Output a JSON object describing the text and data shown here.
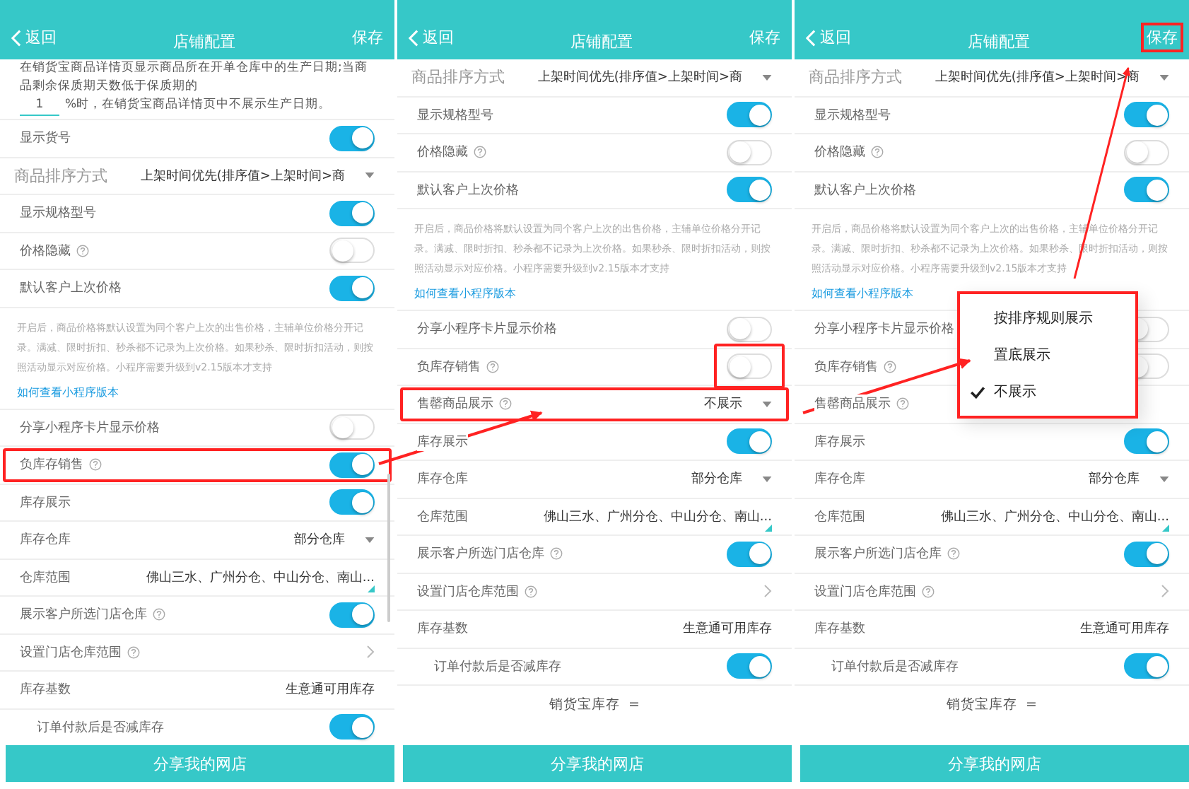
{
  "panels": [
    {
      "header": {
        "back": "返回",
        "title": "店铺配置",
        "save": "保存",
        "save_highlighted": false
      },
      "scrollbar": true,
      "rows": [
        {
          "kind": "note",
          "text_before": "在销货宝商品详情页显示商品所在开单仓库中的生产日期;当商品剩余保质期天数低于保质期的",
          "input": "1",
          "text_after": "%时，在销货宝商品详情页中不展示生产日期。"
        },
        {
          "kind": "toggle",
          "label": "显示货号",
          "help": false,
          "on": true,
          "highlighted": false,
          "switch_highlighted": false
        },
        {
          "kind": "select",
          "label": "商品排序方式",
          "value": "上架时间优先(排序值>上架时间>商",
          "help": false,
          "highlighted": false
        },
        {
          "kind": "toggle",
          "label": "显示规格型号",
          "help": false,
          "on": true,
          "highlighted": false,
          "switch_highlighted": false
        },
        {
          "kind": "toggle",
          "label": "价格隐藏",
          "help": true,
          "on": false,
          "highlighted": false,
          "switch_highlighted": false
        },
        {
          "kind": "toggle",
          "label": "默认客户上次价格",
          "help": false,
          "on": true,
          "highlighted": false,
          "switch_highlighted": false
        },
        {
          "kind": "info",
          "text": "开启后，商品价格将默认设置为同个客户上次的出售价格，主辅单位价格分开记录。满减、限时折扣、秒杀都不记录为上次价格。如果秒杀、限时折扣活动，则按照活动显示对应价格。小程序需要升级到v2.15版本才支持"
        },
        {
          "kind": "link",
          "text": "如何查看小程序版本"
        },
        {
          "kind": "toggle",
          "label": "分享小程序卡片显示价格",
          "help": false,
          "on": false,
          "highlighted": false,
          "switch_highlighted": false
        },
        {
          "kind": "toggle",
          "label": "负库存销售",
          "help": true,
          "on": true,
          "highlighted": true,
          "switch_highlighted": false
        },
        {
          "kind": "toggle",
          "label": "库存展示",
          "help": false,
          "on": true,
          "highlighted": false,
          "switch_highlighted": false
        },
        {
          "kind": "select",
          "label": "库存仓库",
          "value": "部分仓库",
          "help": false,
          "highlighted": false
        },
        {
          "kind": "range",
          "label": "仓库范围",
          "value": "佛山三水、广州分仓、中山分仓、南山..."
        },
        {
          "kind": "toggle",
          "label": "展示客户所选门店仓库",
          "help": true,
          "on": true,
          "highlighted": false,
          "switch_highlighted": false
        },
        {
          "kind": "chevron",
          "label": "设置门店仓库范围",
          "help": true
        },
        {
          "kind": "value",
          "label": "库存基数",
          "value": "生意通可用库存"
        },
        {
          "kind": "subtoggle",
          "label": "订单付款后是否减库存",
          "on": true
        }
      ],
      "footer_button": "分享我的网店"
    },
    {
      "header": {
        "back": "返回",
        "title": "店铺配置",
        "save": "保存",
        "save_highlighted": false
      },
      "scrollbar": false,
      "rows": [
        {
          "kind": "select",
          "label": "商品排序方式",
          "value": "上架时间优先(排序值>上架时间>商",
          "help": false,
          "highlighted": false
        },
        {
          "kind": "toggle",
          "label": "显示规格型号",
          "help": false,
          "on": true,
          "highlighted": false,
          "switch_highlighted": false
        },
        {
          "kind": "toggle",
          "label": "价格隐藏",
          "help": true,
          "on": false,
          "highlighted": false,
          "switch_highlighted": false
        },
        {
          "kind": "toggle",
          "label": "默认客户上次价格",
          "help": false,
          "on": true,
          "highlighted": false,
          "switch_highlighted": false
        },
        {
          "kind": "info",
          "text": "开启后，商品价格将默认设置为同个客户上次的出售价格，主辅单位价格分开记录。满减、限时折扣、秒杀都不记录为上次价格。如果秒杀、限时折扣活动，则按照活动显示对应价格。小程序需要升级到v2.15版本才支持"
        },
        {
          "kind": "link",
          "text": "如何查看小程序版本"
        },
        {
          "kind": "toggle",
          "label": "分享小程序卡片显示价格",
          "help": false,
          "on": false,
          "highlighted": false,
          "switch_highlighted": false
        },
        {
          "kind": "toggle",
          "label": "负库存销售",
          "help": true,
          "on": false,
          "highlighted": false,
          "switch_highlighted": true
        },
        {
          "kind": "select",
          "label": "售罄商品展示",
          "value": "不展示",
          "help": true,
          "highlighted": true
        },
        {
          "kind": "toggle",
          "label": "库存展示",
          "help": false,
          "on": true,
          "highlighted": false,
          "switch_highlighted": false
        },
        {
          "kind": "select",
          "label": "库存仓库",
          "value": "部分仓库",
          "help": false,
          "highlighted": false
        },
        {
          "kind": "range",
          "label": "仓库范围",
          "value": "佛山三水、广州分仓、中山分仓、南山..."
        },
        {
          "kind": "toggle",
          "label": "展示客户所选门店仓库",
          "help": true,
          "on": true,
          "highlighted": false,
          "switch_highlighted": false
        },
        {
          "kind": "chevron",
          "label": "设置门店仓库范围",
          "help": true
        },
        {
          "kind": "value",
          "label": "库存基数",
          "value": "生意通可用库存"
        },
        {
          "kind": "subtoggle",
          "label": "订单付款后是否减库存",
          "on": true
        },
        {
          "kind": "formula",
          "text": "销货宝库存  ="
        }
      ],
      "footer_button": "分享我的网店"
    },
    {
      "header": {
        "back": "返回",
        "title": "店铺配置",
        "save": "保存",
        "save_highlighted": true
      },
      "scrollbar": false,
      "rows": [
        {
          "kind": "select",
          "label": "商品排序方式",
          "value": "上架时间优先(排序值>上架时间>商",
          "help": false,
          "highlighted": false
        },
        {
          "kind": "toggle",
          "label": "显示规格型号",
          "help": false,
          "on": true,
          "highlighted": false,
          "switch_highlighted": false
        },
        {
          "kind": "toggle",
          "label": "价格隐藏",
          "help": true,
          "on": false,
          "highlighted": false,
          "switch_highlighted": false
        },
        {
          "kind": "toggle",
          "label": "默认客户上次价格",
          "help": false,
          "on": true,
          "highlighted": false,
          "switch_highlighted": false
        },
        {
          "kind": "info",
          "text": "开启后，商品价格将默认设置为同个客户上次的出售价格，主辅单位价格分开记录。满减、限时折扣、秒杀都不记录为上次价格。如果秒杀、限时折扣活动，则按照活动显示对应价格。小程序需要升级到v2.15版本才支持"
        },
        {
          "kind": "link",
          "text": "如何查看小程序版本"
        },
        {
          "kind": "toggle",
          "label": "分享小程序卡片显示价格",
          "help": false,
          "on": false,
          "highlighted": false,
          "switch_highlighted": false
        },
        {
          "kind": "toggle",
          "label": "负库存销售",
          "help": true,
          "on": false,
          "highlighted": false,
          "switch_highlighted": false
        },
        {
          "kind": "select",
          "label": "售罄商品展示",
          "help": true,
          "highlighted": false
        },
        {
          "kind": "toggle",
          "label": "库存展示",
          "help": false,
          "on": true,
          "highlighted": false,
          "switch_highlighted": false
        },
        {
          "kind": "select",
          "label": "库存仓库",
          "value": "部分仓库",
          "help": false,
          "highlighted": false
        },
        {
          "kind": "range",
          "label": "仓库范围",
          "value": "佛山三水、广州分仓、中山分仓、南山..."
        },
        {
          "kind": "toggle",
          "label": "展示客户所选门店仓库",
          "help": true,
          "on": true,
          "highlighted": false,
          "switch_highlighted": false
        },
        {
          "kind": "chevron",
          "label": "设置门店仓库范围",
          "help": true
        },
        {
          "kind": "value",
          "label": "库存基数",
          "value": "生意通可用库存"
        },
        {
          "kind": "subtoggle",
          "label": "订单付款后是否减库存",
          "on": true
        },
        {
          "kind": "formula",
          "text": "销货宝库存  ="
        }
      ],
      "menu": {
        "highlighted": true,
        "items": [
          {
            "label": "按排序规则展示",
            "selected": false
          },
          {
            "label": "置底展示",
            "selected": false
          },
          {
            "label": "不展示",
            "selected": true
          }
        ]
      },
      "footer_button": "分享我的网店"
    }
  ]
}
